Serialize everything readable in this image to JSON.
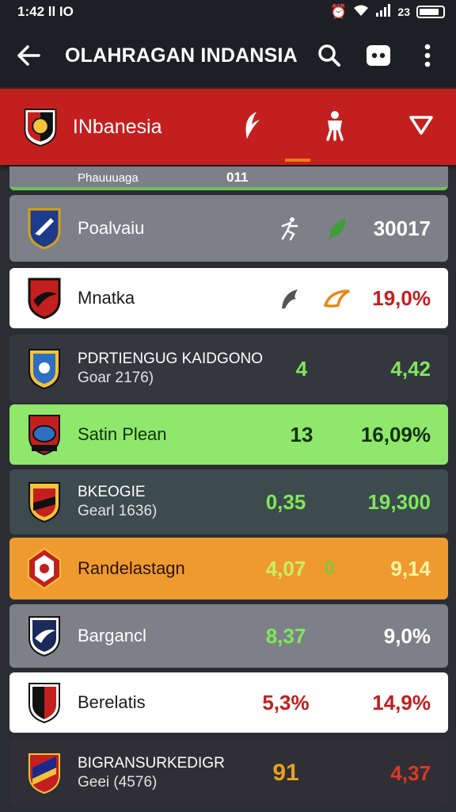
{
  "status": {
    "time": "1:42",
    "indicators": "ll IO",
    "network": "23"
  },
  "appbar": {
    "title": "OLAHRAGAN INDANSIA"
  },
  "header": {
    "team_name": "INbanesia"
  },
  "partial_row": {
    "name": "Phauuuaga",
    "value": "011"
  },
  "rows": [
    {
      "name": "Poalvaiu",
      "sub": "",
      "mid": "",
      "value": "30017",
      "bg": "#7d8088",
      "name_color": "#ffffff",
      "value_color": "#ffffff",
      "mid_color": "#ffffff"
    },
    {
      "name": "Mnatka",
      "sub": "",
      "mid": "",
      "value": "19,0%",
      "bg": "#ffffff",
      "name_color": "#1b1b1b",
      "value_color": "#c21e1e",
      "mid_color": "#1b1b1b"
    },
    {
      "name": "PDRTIENGUG KAIDGONO",
      "sub": "Goar 2176)",
      "mid": "4",
      "value": "4,42",
      "bg": "#35373e",
      "name_color": "#ffffff",
      "value_color": "#7ee85a",
      "mid_color": "#7ee85a"
    },
    {
      "name": "Satin Plean",
      "sub": "",
      "mid": "13",
      "value": "16,09%",
      "bg": "#8fe86b",
      "name_color": "#10300a",
      "value_color": "#10300a",
      "mid_color": "#10300a"
    },
    {
      "name": "BKEOGIE",
      "sub": "Gearl 1636)",
      "mid": "0,35",
      "value": "19,300",
      "bg": "#3d4a4e",
      "name_color": "#ffffff",
      "value_color": "#7ee85a",
      "mid_color": "#7ee85a"
    },
    {
      "name": "Randelastagn",
      "sub": "",
      "mid": "4,07",
      "value": "9,14",
      "bg": "#ef9a2e",
      "name_color": "#2b1400",
      "value_color": "#fff5a0",
      "mid_color": "#c8f060"
    },
    {
      "name": "Bargancl",
      "sub": "",
      "mid": "8,37",
      "value": "9,0%",
      "bg": "#7d8088",
      "name_color": "#ffffff",
      "value_color": "#ffffff",
      "mid_color": "#7ee85a"
    },
    {
      "name": "Berelatis",
      "sub": "",
      "mid": "5,3%",
      "value": "14,9%",
      "bg": "#ffffff",
      "name_color": "#1b1b1b",
      "value_color": "#c21e1e",
      "mid_color": "#c21e1e"
    },
    {
      "name": "BIGRANSURKEDIGR",
      "sub": "Geei (4576)",
      "mid": "91",
      "value": "4,37",
      "bg": "#2f2f35",
      "name_color": "#ffffff",
      "value_color": "#e0362a",
      "mid_color": "#e8a020"
    }
  ]
}
